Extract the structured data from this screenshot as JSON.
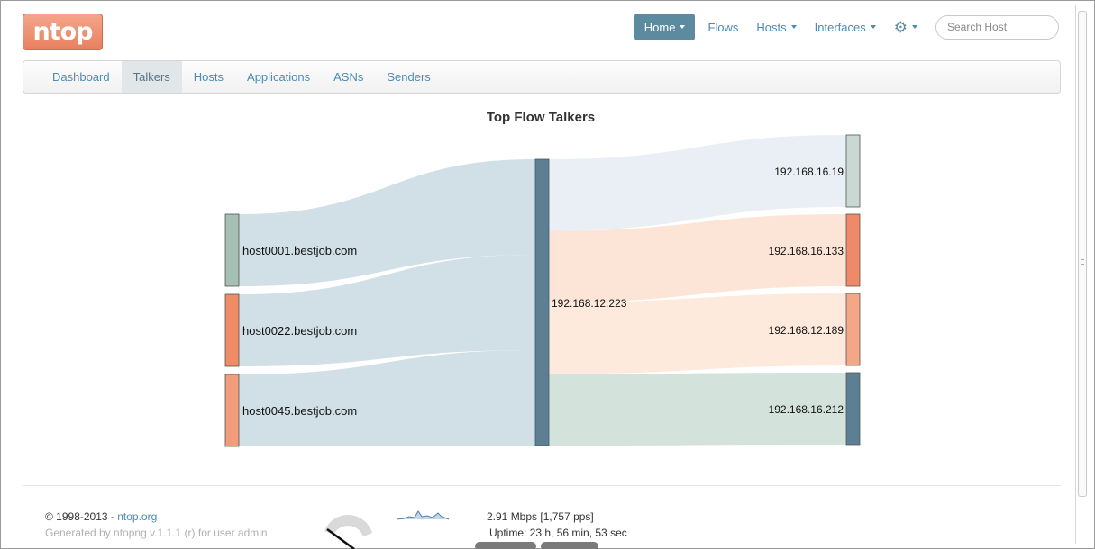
{
  "brand": {
    "logo_text": "ntop"
  },
  "topnav": {
    "home": "Home",
    "flows": "Flows",
    "hosts": "Hosts",
    "interfaces": "Interfaces",
    "search_placeholder": "Search Host"
  },
  "tabs": [
    "Dashboard",
    "Talkers",
    "Hosts",
    "Applications",
    "ASNs",
    "Senders"
  ],
  "active_tab": "Talkers",
  "chart_title": "Top Flow Talkers",
  "chart_data": {
    "type": "sankey",
    "title": "Top Flow Talkers",
    "nodes": {
      "sources": [
        {
          "label": "host0001.bestjob.com",
          "color": "#a6bfb4"
        },
        {
          "label": "host0022.bestjob.com",
          "color": "#ef8c65"
        },
        {
          "label": "host0045.bestjob.com",
          "color": "#f19c7b"
        }
      ],
      "hub": {
        "label": "192.168.12.223",
        "color": "#5c7f94"
      },
      "targets": [
        {
          "label": "192.168.16.19",
          "color": "#c9d8d3"
        },
        {
          "label": "192.168.16.133",
          "color": "#ee8a67"
        },
        {
          "label": "192.168.12.189",
          "color": "#f3a786"
        },
        {
          "label": "192.168.16.212",
          "color": "#5c7f94"
        }
      ]
    },
    "links_in": [
      {
        "source": "host0001.bestjob.com",
        "target": "192.168.12.223",
        "value": 1
      },
      {
        "source": "host0022.bestjob.com",
        "target": "192.168.12.223",
        "value": 1
      },
      {
        "source": "host0045.bestjob.com",
        "target": "192.168.12.223",
        "value": 1
      }
    ],
    "links_out": [
      {
        "source": "192.168.12.223",
        "target": "192.168.16.19",
        "value": 1,
        "color": "#e8eef3"
      },
      {
        "source": "192.168.12.223",
        "target": "192.168.16.133",
        "value": 1,
        "color": "#fce4d5"
      },
      {
        "source": "192.168.12.223",
        "target": "192.168.12.189",
        "value": 1,
        "color": "#fde9da"
      },
      {
        "source": "192.168.12.223",
        "target": "192.168.16.212",
        "value": 1,
        "color": "#d2e0da"
      }
    ],
    "in_link_color": "#cfdde6"
  },
  "footer": {
    "copyright_prefix": "© 1998-2013 - ",
    "copyright_link": "ntop.org",
    "generated": "Generated by ntopng v.1.1.1 (r) for user admin",
    "throughput": "2.91 Mbps [1,757 pps]",
    "uptime": "Uptime: 23 h, 56 min, 53 sec"
  }
}
